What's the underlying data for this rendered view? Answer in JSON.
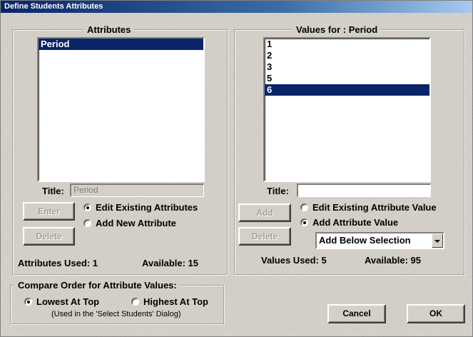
{
  "window": {
    "title": "Define Students Attributes"
  },
  "attributes_panel": {
    "legend": "Attributes",
    "items": [
      {
        "label": "Period",
        "selected": true
      }
    ],
    "title_label": "Title:",
    "title_value": "Period",
    "enter_label": "Enter",
    "delete_label": "Delete",
    "radio_edit": "Edit Existing Attributes",
    "radio_add": "Add New Attribute",
    "mode": "edit",
    "used_label": "Attributes Used: 1",
    "available_label": "Available: 15"
  },
  "values_panel": {
    "legend": "Values for : Period",
    "items": [
      {
        "label": "1",
        "selected": false
      },
      {
        "label": "2",
        "selected": false
      },
      {
        "label": "3",
        "selected": false
      },
      {
        "label": "5",
        "selected": false
      },
      {
        "label": "6",
        "selected": true
      }
    ],
    "title_label": "Title:",
    "title_value": "",
    "add_label": "Add",
    "delete_label": "Delete",
    "radio_edit": "Edit Existing Attribute Value",
    "radio_add": "Add Attribute Value",
    "mode": "add",
    "position_select": "Add Below Selection",
    "used_label": "Values Used: 5",
    "available_label": "Available: 95"
  },
  "compare_order": {
    "legend": "Compare Order for Attribute Values:",
    "radio_lowest": "Lowest At Top",
    "radio_highest": "Highest At Top",
    "selected": "lowest",
    "note": "(Used in the 'Select Students' Dialog)"
  },
  "buttons": {
    "cancel": "Cancel",
    "ok": "OK"
  }
}
